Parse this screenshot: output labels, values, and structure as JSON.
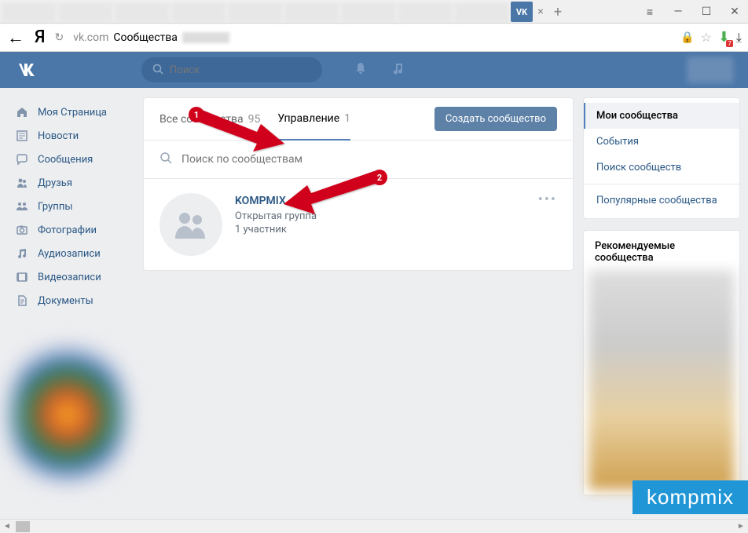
{
  "browser": {
    "active_tab_icon": "VK",
    "url_domain": "vk.com",
    "url_page": "Сообщества",
    "download_count": "7"
  },
  "topbar": {
    "search_placeholder": "Поиск"
  },
  "sidebar": {
    "items": [
      {
        "icon": "home",
        "label": "Моя Страница"
      },
      {
        "icon": "news",
        "label": "Новости"
      },
      {
        "icon": "msg",
        "label": "Сообщения"
      },
      {
        "icon": "friends",
        "label": "Друзья"
      },
      {
        "icon": "groups",
        "label": "Группы"
      },
      {
        "icon": "photo",
        "label": "Фотографии"
      },
      {
        "icon": "audio",
        "label": "Аудиозаписи"
      },
      {
        "icon": "video",
        "label": "Видеозаписи"
      },
      {
        "icon": "docs",
        "label": "Документы"
      }
    ]
  },
  "tabs": {
    "all_label": "Все сообщества",
    "all_count": "95",
    "manage_label": "Управление",
    "manage_count": "1",
    "create_btn": "Создать сообщество"
  },
  "search": {
    "placeholder": "Поиск по сообществам"
  },
  "group": {
    "name": "KOMPMIX",
    "type": "Открытая группа",
    "members": "1 участник"
  },
  "right_menu": {
    "items": [
      {
        "label": "Мои сообщества",
        "active": true
      },
      {
        "label": "События"
      },
      {
        "label": "Поиск сообществ"
      },
      {
        "label": "Популярные сообщества"
      }
    ],
    "rec_title": "Рекомендуемые сообщества"
  },
  "annotations": {
    "badge1": "1",
    "badge2": "2"
  },
  "watermark": "kompmix"
}
